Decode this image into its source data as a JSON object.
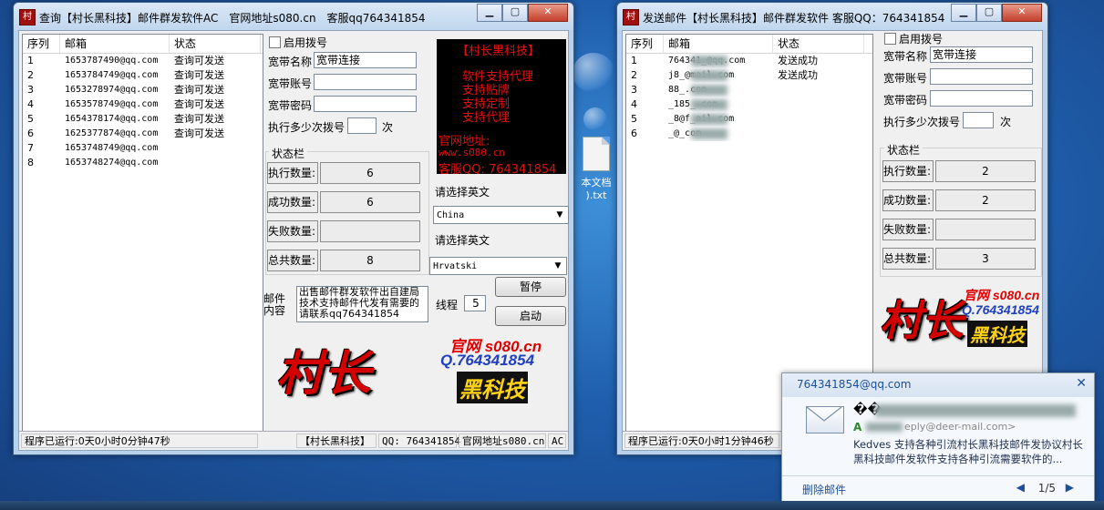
{
  "desktop": {
    "file_label_1": "本文档",
    "file_label_2": ").txt"
  },
  "window1": {
    "title": "查询【村长黑科技】邮件群发软件AC　官网地址s080.cn　客服qq764341854",
    "list_headers": [
      "序列",
      "邮箱",
      "状态"
    ],
    "rows": [
      {
        "no": "1",
        "email": "1653787490@qq.com",
        "status": "查询可发送"
      },
      {
        "no": "2",
        "email": "1653784749@qq.com",
        "status": "查询可发送"
      },
      {
        "no": "3",
        "email": "1653278974@qq.com",
        "status": "查询可发送"
      },
      {
        "no": "4",
        "email": "1653578749@qq.com",
        "status": "查询可发送"
      },
      {
        "no": "5",
        "email": "1654378174@qq.com",
        "status": "查询可发送"
      },
      {
        "no": "6",
        "email": "1625377874@qq.com",
        "status": "查询可发送"
      },
      {
        "no": "7",
        "email": "1653748749@qq.com",
        "status": ""
      },
      {
        "no": "8",
        "email": "1653748274@qq.com",
        "status": ""
      }
    ],
    "enable_dialup_label": "启用拨号",
    "broadband_name_label": "宽带名称",
    "broadband_name_value": "宽带连接",
    "broadband_account_label": "宽带账号",
    "broadband_password_label": "宽带密码",
    "dial_every_label": "执行多少次拨号",
    "dial_every_unit": "次",
    "status_group_title": "状态栏",
    "stats": [
      {
        "label": "执行数量:",
        "value": "6"
      },
      {
        "label": "成功数量:",
        "value": "6"
      },
      {
        "label": "失败数量:",
        "value": ""
      },
      {
        "label": "总共数量:",
        "value": "8"
      }
    ],
    "promo_lines": [
      "【村长黑科技】",
      "软件支持代理",
      "支持贴牌",
      "支持定制",
      "支持代理",
      "官网地址:",
      "www.s080.cn",
      "客服QQ: 764341854"
    ],
    "select_english_label_1": "请选择英文",
    "country_select_1": "China",
    "select_english_label_2": "请选择英文",
    "country_select_2": "Hrvatski",
    "mail_content_label": "邮件内容",
    "mail_content_value": "出售邮件群发软件出自建局技术支持邮件代发有需要的请联系qq764341854",
    "threads_label": "线程",
    "threads_value": "5",
    "pause_button": "暂停",
    "start_button": "启动",
    "logo": {
      "mark": "村长",
      "site": "官网 s080.cn",
      "qq": "Q.764341854",
      "brand": "黑科技"
    },
    "statusbar": {
      "runtime": "程序已运行:0天0小时0分钟47秒",
      "brand": "【村长黑科技】",
      "qq": "QQ: 764341854",
      "site": "官网地址s080.cn",
      "ac": "AC"
    }
  },
  "window2": {
    "title": "发送邮件【村长黑科技】邮件群发软件 客服QQ：764341854",
    "list_headers": [
      "序列",
      "邮箱",
      "状态"
    ],
    "rows": [
      {
        "no": "1",
        "email": "764341_@qq.com",
        "status": "发送成功"
      },
      {
        "no": "2",
        "email": "j8_@mail.com",
        "status": "发送成功"
      },
      {
        "no": "3",
        "email": "88_.com",
        "status": ""
      },
      {
        "no": "4",
        "email": "_185_.com",
        "status": ""
      },
      {
        "no": "5",
        "email": "_8@f_ail.com",
        "status": ""
      },
      {
        "no": "6",
        "email": "_@_com",
        "status": ""
      }
    ],
    "enable_dialup_label": "启用拨号",
    "broadband_name_label": "宽带名称",
    "broadband_name_value": "宽带连接",
    "broadband_account_label": "宽带账号",
    "broadband_password_label": "宽带密码",
    "dial_every_label": "执行多少次拨号",
    "dial_every_unit": "次",
    "status_group_title": "状态栏",
    "stats": [
      {
        "label": "执行数量:",
        "value": "2"
      },
      {
        "label": "成功数量:",
        "value": "2"
      },
      {
        "label": "失败数量:",
        "value": ""
      },
      {
        "label": "总共数量:",
        "value": "3"
      }
    ],
    "logo": {
      "mark": "村长",
      "site": "官网 s080.cn",
      "qq": "Q.764341854",
      "brand": "黑科技"
    },
    "statusbar": {
      "runtime": "程序已运行:0天0小时1分钟46秒"
    }
  },
  "notification": {
    "account": "764341854@qq.com",
    "sender": "��",
    "sender_initial": "A",
    "reply_snippet": "eply@deer-mail.com>",
    "body": "Kedves 支持各种引流村长黑科技邮件发协议村长黑科技邮件发软件支持各种引流需要软件的...",
    "delete_label": "删除邮件",
    "pager": "1/5"
  }
}
